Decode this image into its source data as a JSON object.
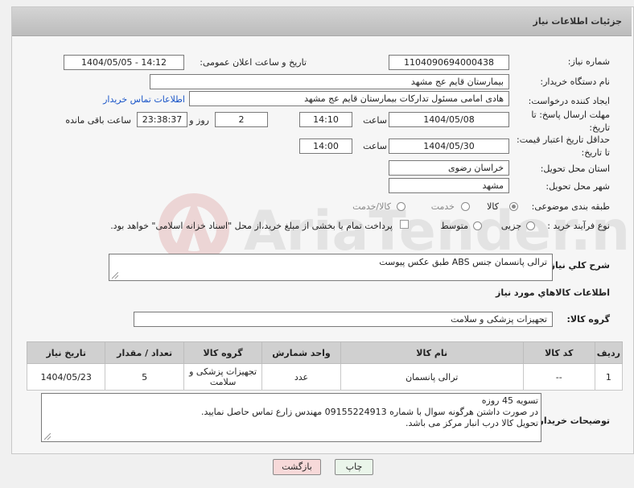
{
  "header": {
    "title": "جزئیات اطلاعات نیاز"
  },
  "labels": {
    "need_number": "شماره نیاز:",
    "announce_datetime": "تاریخ و ساعت اعلان عمومی:",
    "buyer_org": "نام دستگاه خریدار:",
    "requester": "ایجاد کننده درخواست:",
    "contact_link": "اطلاعات تماس خریدار",
    "reply_deadline_1": "مهلت ارسال پاسخ: تا",
    "reply_deadline_2": "تاریخ:",
    "time_word": "ساعت",
    "days_word": "روز و",
    "remaining_word": "ساعت باقی مانده",
    "price_validity_1": "حداقل تاریخ اعتبار قیمت:",
    "price_validity_2": "تا تاریخ:",
    "delivery_province": "استان محل تحویل:",
    "delivery_city": "شهر محل تحویل:",
    "category": "طبقه بندی موضوعی:",
    "process_type": "نوع فرآیند خرید :",
    "general_desc": "شرح کلي نياز:",
    "goods_info": "اطلاعات کالاهاي مورد نياز",
    "goods_group": "گروه کالا:",
    "buyer_notes": "توضیحات خریدار:"
  },
  "values": {
    "need_number": "1104090694000438",
    "announce_datetime": "1404/05/05 - 14:12",
    "buyer_org": "بیمارستان قایم  عج  مشهد",
    "requester": "هادی امامی مسئول تدارکات بیمارستان قایم  عج  مشهد",
    "reply_date": "1404/05/08",
    "reply_time": "14:10",
    "reply_days": "2",
    "reply_remaining": "23:38:37",
    "price_date": "1404/05/30",
    "price_time": "14:00",
    "delivery_province": "خراسان رضوی",
    "delivery_city": "مشهد",
    "general_desc": "ترالی پانسمان جنس ABS  طبق عکس پیوست",
    "goods_group": "تجهیزات پزشکی و سلامت",
    "buyer_notes_line1": "تسویه 45  روزه",
    "buyer_notes_line2": "در صورت داشتن هرگونه سوال با  شماره 09155224913  مهندس  زارع تماس حاصل نمایید.",
    "buyer_notes_line3": "تحویل کالا درب انبار مرکز می باشد."
  },
  "category_options": [
    {
      "label": "کالا",
      "selected": true
    },
    {
      "label": "خدمت",
      "selected": false
    },
    {
      "label": "کالا/خدمت",
      "selected": false
    }
  ],
  "process_options": [
    {
      "label": "جزیی",
      "selected": false
    },
    {
      "label": "متوسط",
      "selected": false
    }
  ],
  "payment_note": "پرداخت تمام یا بخشی از مبلغ خرید،از محل \"اسناد خزانه اسلامی\" خواهد بود.",
  "table": {
    "headers": [
      "ردیف",
      "کد کالا",
      "نام کالا",
      "واحد شمارش",
      "گروه کالا",
      "تعداد / مقدار",
      "تاریخ نیاز"
    ],
    "rows": [
      [
        "1",
        "--",
        "ترالی پانسمان",
        "عدد",
        "تجهیزات پزشکی و سلامت",
        "5",
        "1404/05/23"
      ]
    ]
  },
  "buttons": {
    "print": "چاپ",
    "back": "بازگشت"
  },
  "watermark_text": "AriaTender.neT",
  "colors": {
    "link": "#1a55c8",
    "back_button": "#f7d9d9",
    "print_button": "#eaf5ea"
  }
}
